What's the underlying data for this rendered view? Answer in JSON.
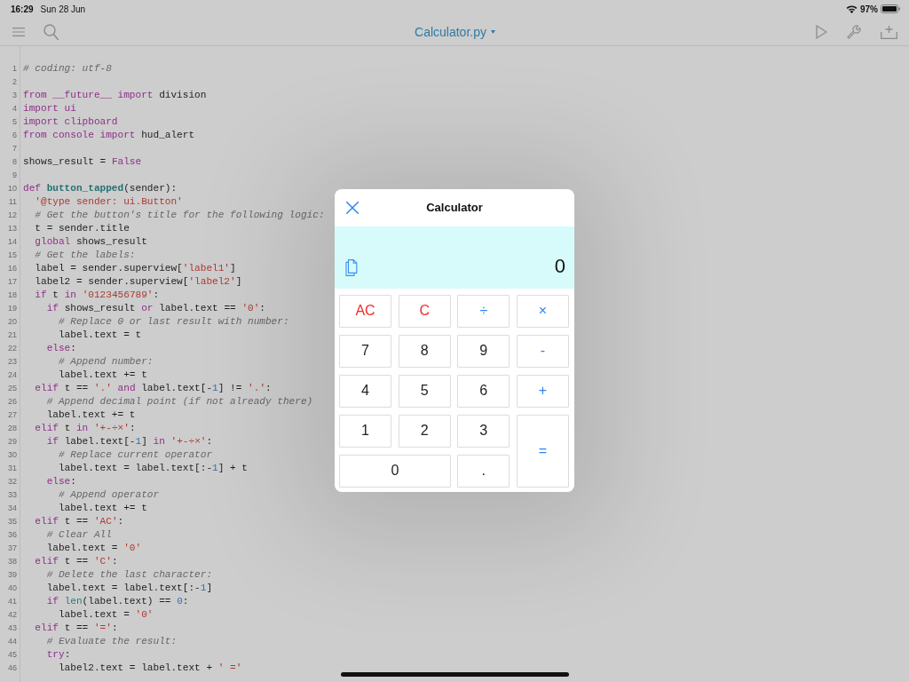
{
  "status_bar": {
    "time": "16:29",
    "date": "Sun 28 Jun",
    "battery": "97%"
  },
  "toolbar": {
    "title": "Calculator.py"
  },
  "editor": {
    "lines": [
      {
        "number": "1",
        "tokens": [
          {
            "text": "# coding: utf-8",
            "kind": "comment"
          }
        ]
      },
      {
        "number": "2"
      },
      {
        "number": "3",
        "tokens": [
          {
            "text": "from __future__ import",
            "kind": "keyword"
          },
          {
            "text": " division",
            "kind": "plain"
          }
        ]
      },
      {
        "number": "4",
        "tokens": [
          {
            "text": "import ui",
            "kind": "keyword"
          }
        ]
      },
      {
        "number": "5",
        "tokens": [
          {
            "text": "import clipboard",
            "kind": "keyword"
          }
        ]
      },
      {
        "number": "6",
        "tokens": [
          {
            "text": "from console import",
            "kind": "keyword"
          },
          {
            "text": " hud_alert",
            "kind": "plain"
          }
        ]
      },
      {
        "number": "7"
      },
      {
        "number": "8",
        "tokens": [
          {
            "text": "shows_result = ",
            "kind": "plain"
          },
          {
            "text": "False",
            "kind": "keyword"
          }
        ]
      },
      {
        "number": "9"
      },
      {
        "number": "10",
        "tokens": [
          {
            "text": "def ",
            "kind": "keyword"
          },
          {
            "text": "button_tapped",
            "kind": "function"
          },
          {
            "text": "(sender):",
            "kind": "plain"
          }
        ]
      },
      {
        "number": "11",
        "tokens": [
          {
            "text": "  '@type sender: ui.Button'",
            "kind": "string"
          }
        ]
      },
      {
        "number": "12",
        "tokens": [
          {
            "text": "  # Get the button's title for the following logic:",
            "kind": "comment"
          }
        ]
      },
      {
        "number": "13",
        "tokens": [
          {
            "text": "  t = sender.title",
            "kind": "plain"
          }
        ]
      },
      {
        "number": "14",
        "tokens": [
          {
            "text": "  global",
            "kind": "keyword"
          },
          {
            "text": " shows_result",
            "kind": "plain"
          }
        ]
      },
      {
        "number": "15",
        "tokens": [
          {
            "text": "  # Get the labels:",
            "kind": "comment"
          }
        ]
      },
      {
        "number": "16",
        "tokens": [
          {
            "text": "  label = sender.superview[",
            "kind": "plain"
          },
          {
            "text": "'label1'",
            "kind": "string"
          },
          {
            "text": "]",
            "kind": "plain"
          }
        ]
      },
      {
        "number": "17",
        "tokens": [
          {
            "text": "  label2 = sender.superview[",
            "kind": "plain"
          },
          {
            "text": "'label2'",
            "kind": "string"
          },
          {
            "text": "]",
            "kind": "plain"
          }
        ]
      },
      {
        "number": "18",
        "tokens": [
          {
            "text": "  if",
            "kind": "keyword"
          },
          {
            "text": " t ",
            "kind": "plain"
          },
          {
            "text": "in",
            "kind": "keyword"
          },
          {
            "text": " '0123456789'",
            "kind": "string"
          },
          {
            "text": ":",
            "kind": "plain"
          }
        ]
      },
      {
        "number": "19",
        "tokens": [
          {
            "text": "    if",
            "kind": "keyword"
          },
          {
            "text": " shows_result ",
            "kind": "plain"
          },
          {
            "text": "or",
            "kind": "keyword"
          },
          {
            "text": " label.text == ",
            "kind": "plain"
          },
          {
            "text": "'0'",
            "kind": "string"
          },
          {
            "text": ":",
            "kind": "plain"
          }
        ]
      },
      {
        "number": "20",
        "tokens": [
          {
            "text": "      # Replace 0 or last result with number:",
            "kind": "comment"
          }
        ]
      },
      {
        "number": "21",
        "tokens": [
          {
            "text": "      label.text = t",
            "kind": "plain"
          }
        ]
      },
      {
        "number": "22",
        "tokens": [
          {
            "text": "    else",
            "kind": "keyword"
          },
          {
            "text": ":",
            "kind": "plain"
          }
        ]
      },
      {
        "number": "23",
        "tokens": [
          {
            "text": "      # Append number:",
            "kind": "comment"
          }
        ]
      },
      {
        "number": "24",
        "tokens": [
          {
            "text": "      label.text += t",
            "kind": "plain"
          }
        ]
      },
      {
        "number": "25",
        "tokens": [
          {
            "text": "  elif",
            "kind": "keyword"
          },
          {
            "text": " t == ",
            "kind": "plain"
          },
          {
            "text": "'.'",
            "kind": "string"
          },
          {
            "text": " and",
            "kind": "keyword"
          },
          {
            "text": " label.text[-",
            "kind": "plain"
          },
          {
            "text": "1",
            "kind": "number"
          },
          {
            "text": "] != ",
            "kind": "plain"
          },
          {
            "text": "'.'",
            "kind": "string"
          },
          {
            "text": ":",
            "kind": "plain"
          }
        ]
      },
      {
        "number": "26",
        "tokens": [
          {
            "text": "    # Append decimal point (if not already there)",
            "kind": "comment"
          }
        ]
      },
      {
        "number": "27",
        "tokens": [
          {
            "text": "    label.text += t",
            "kind": "plain"
          }
        ]
      },
      {
        "number": "28",
        "tokens": [
          {
            "text": "  elif",
            "kind": "keyword"
          },
          {
            "text": " t ",
            "kind": "plain"
          },
          {
            "text": "in",
            "kind": "keyword"
          },
          {
            "text": " '+-÷×'",
            "kind": "string"
          },
          {
            "text": ":",
            "kind": "plain"
          }
        ]
      },
      {
        "number": "29",
        "tokens": [
          {
            "text": "    if",
            "kind": "keyword"
          },
          {
            "text": " label.text[-",
            "kind": "plain"
          },
          {
            "text": "1",
            "kind": "number"
          },
          {
            "text": "] ",
            "kind": "plain"
          },
          {
            "text": "in",
            "kind": "keyword"
          },
          {
            "text": " '+-÷×'",
            "kind": "string"
          },
          {
            "text": ":",
            "kind": "plain"
          }
        ]
      },
      {
        "number": "30",
        "tokens": [
          {
            "text": "      # Replace current operator",
            "kind": "comment"
          }
        ]
      },
      {
        "number": "31",
        "tokens": [
          {
            "text": "      label.text = label.text[:-",
            "kind": "plain"
          },
          {
            "text": "1",
            "kind": "number"
          },
          {
            "text": "] + t",
            "kind": "plain"
          }
        ]
      },
      {
        "number": "32",
        "tokens": [
          {
            "text": "    else",
            "kind": "keyword"
          },
          {
            "text": ":",
            "kind": "plain"
          }
        ]
      },
      {
        "number": "33",
        "tokens": [
          {
            "text": "      # Append operator",
            "kind": "comment"
          }
        ]
      },
      {
        "number": "34",
        "tokens": [
          {
            "text": "      label.text += t",
            "kind": "plain"
          }
        ]
      },
      {
        "number": "35",
        "tokens": [
          {
            "text": "  elif",
            "kind": "keyword"
          },
          {
            "text": " t == ",
            "kind": "plain"
          },
          {
            "text": "'AC'",
            "kind": "string"
          },
          {
            "text": ":",
            "kind": "plain"
          }
        ]
      },
      {
        "number": "36",
        "tokens": [
          {
            "text": "    # Clear All",
            "kind": "comment"
          }
        ]
      },
      {
        "number": "37",
        "tokens": [
          {
            "text": "    label.text = ",
            "kind": "plain"
          },
          {
            "text": "'0'",
            "kind": "string"
          }
        ]
      },
      {
        "number": "38",
        "tokens": [
          {
            "text": "  elif",
            "kind": "keyword"
          },
          {
            "text": " t == ",
            "kind": "plain"
          },
          {
            "text": "'C'",
            "kind": "string"
          },
          {
            "text": ":",
            "kind": "plain"
          }
        ]
      },
      {
        "number": "39",
        "tokens": [
          {
            "text": "    # Delete the last character:",
            "kind": "comment"
          }
        ]
      },
      {
        "number": "40",
        "tokens": [
          {
            "text": "    label.text = label.text[:-",
            "kind": "plain"
          },
          {
            "text": "1",
            "kind": "number"
          },
          {
            "text": "]",
            "kind": "plain"
          }
        ]
      },
      {
        "number": "41",
        "tokens": [
          {
            "text": "    if ",
            "kind": "keyword"
          },
          {
            "text": "len",
            "kind": "builtin"
          },
          {
            "text": "(label.text) == ",
            "kind": "plain"
          },
          {
            "text": "0",
            "kind": "number"
          },
          {
            "text": ":",
            "kind": "plain"
          }
        ]
      },
      {
        "number": "42",
        "tokens": [
          {
            "text": "      label.text = ",
            "kind": "plain"
          },
          {
            "text": "'0'",
            "kind": "string"
          }
        ]
      },
      {
        "number": "43",
        "tokens": [
          {
            "text": "  elif",
            "kind": "keyword"
          },
          {
            "text": " t == ",
            "kind": "plain"
          },
          {
            "text": "'='",
            "kind": "string"
          },
          {
            "text": ":",
            "kind": "plain"
          }
        ]
      },
      {
        "number": "44",
        "tokens": [
          {
            "text": "    # Evaluate the result:",
            "kind": "comment"
          }
        ]
      },
      {
        "number": "45",
        "tokens": [
          {
            "text": "    try",
            "kind": "keyword"
          },
          {
            "text": ":",
            "kind": "plain"
          }
        ]
      },
      {
        "number": "46",
        "tokens": [
          {
            "text": "      label2.text = label.text + ",
            "kind": "plain"
          },
          {
            "text": "' ='",
            "kind": "string"
          }
        ]
      }
    ]
  },
  "dialog": {
    "title": "Calculator",
    "display": "0",
    "keys": [
      {
        "label": "AC",
        "kind": "clear"
      },
      {
        "label": "C",
        "kind": "clear"
      },
      {
        "label": "÷",
        "kind": "operator"
      },
      {
        "label": "×",
        "kind": "operator"
      },
      {
        "label": "7",
        "kind": "digit"
      },
      {
        "label": "8",
        "kind": "digit"
      },
      {
        "label": "9",
        "kind": "digit"
      },
      {
        "label": "-",
        "kind": "operator"
      },
      {
        "label": "4",
        "kind": "digit"
      },
      {
        "label": "5",
        "kind": "digit"
      },
      {
        "label": "6",
        "kind": "digit"
      },
      {
        "label": "+",
        "kind": "operator"
      },
      {
        "label": "1",
        "kind": "digit"
      },
      {
        "label": "2",
        "kind": "digit"
      },
      {
        "label": "3",
        "kind": "digit"
      },
      {
        "label": "=",
        "kind": "operator"
      },
      {
        "label": "0",
        "kind": "digit"
      },
      {
        "label": ".",
        "kind": "digit"
      }
    ]
  }
}
